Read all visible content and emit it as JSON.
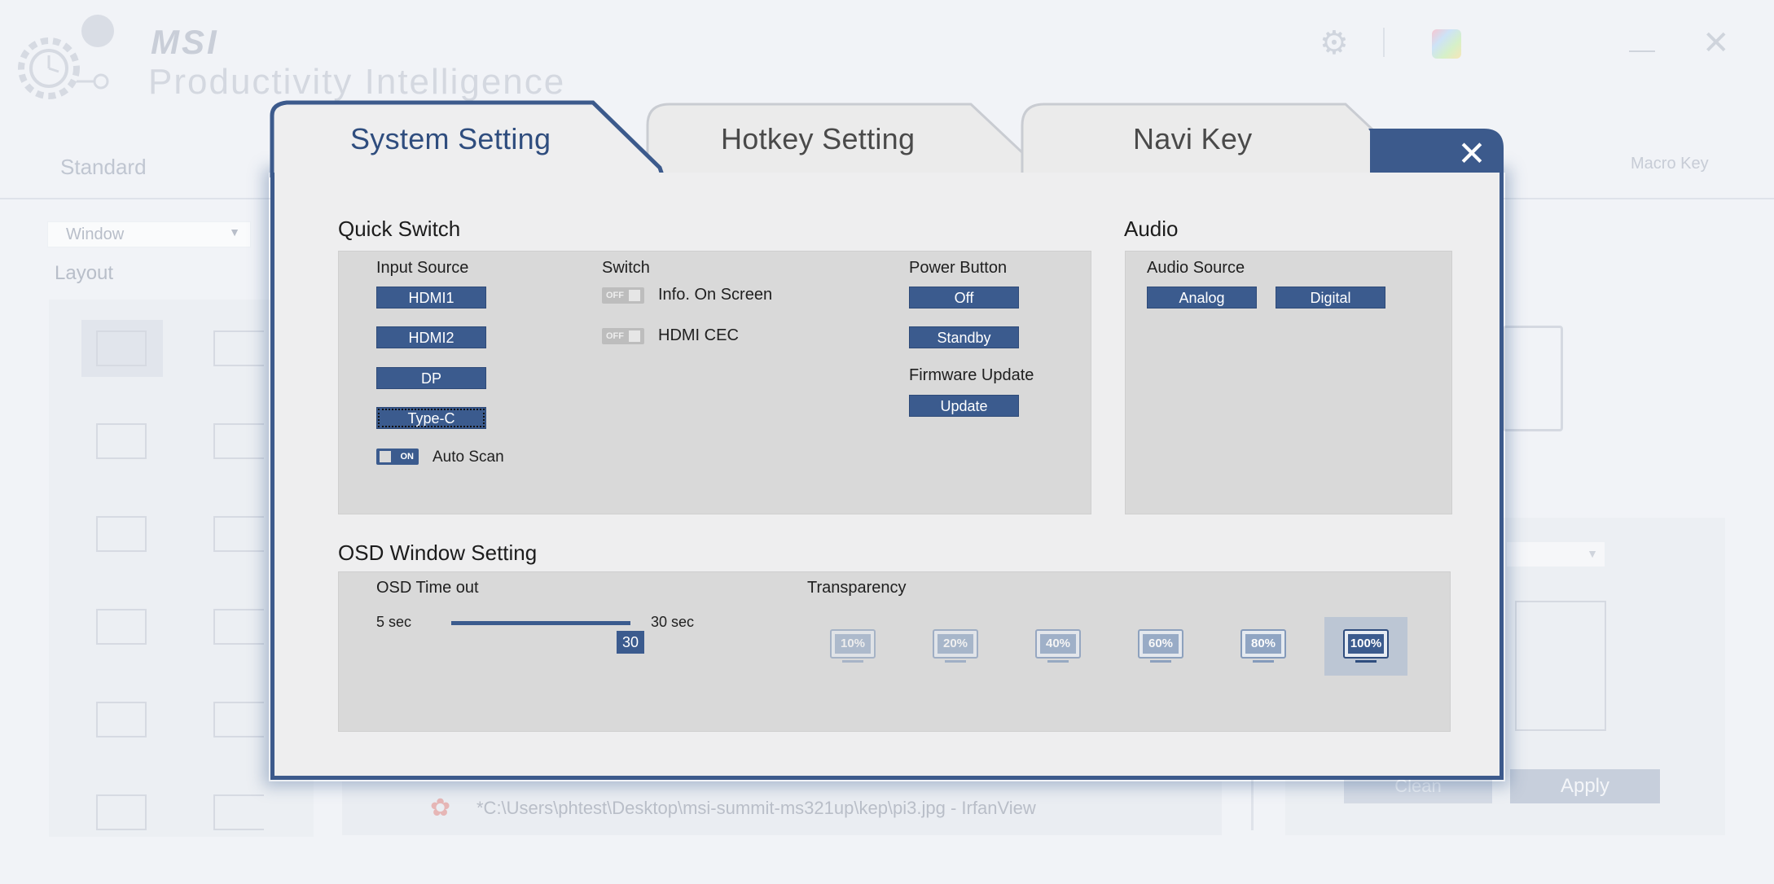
{
  "background": {
    "brand": "MSI",
    "app_title": "Productivity Intelligence",
    "tab_standard": "Standard",
    "tab_macro": "Macro Key",
    "window_select": "Window",
    "layout_label": "Layout",
    "recent_path": "*C:\\Users\\phtest\\Desktop\\msi-summit-ms321up\\kep\\pi3.jpg - IrfanView",
    "clean_label": "Clean",
    "apply_label": "Apply"
  },
  "dialog": {
    "tabs": [
      "System Setting",
      "Hotkey Setting",
      "Navi Key"
    ],
    "active_tab": "System Setting",
    "close_icon": "close-icon",
    "accent_color": "#3b5b8e"
  },
  "quick_switch": {
    "title": "Quick Switch",
    "input_source": {
      "label": "Input Source",
      "buttons": [
        "HDMI1",
        "HDMI2",
        "DP",
        "Type-C"
      ],
      "auto_scan": {
        "label": "Auto Scan",
        "state": "ON"
      }
    },
    "switch": {
      "label": "Switch",
      "items": [
        {
          "label": "Info. On Screen",
          "state": "OFF"
        },
        {
          "label": "HDMI CEC",
          "state": "OFF"
        }
      ]
    },
    "power_button": {
      "label": "Power Button",
      "buttons": [
        "Off",
        "Standby"
      ]
    },
    "firmware_update": {
      "label": "Firmware Update",
      "button": "Update"
    }
  },
  "audio": {
    "title": "Audio",
    "source_label": "Audio Source",
    "buttons": [
      "Analog",
      "Digital"
    ]
  },
  "osd": {
    "title": "OSD Window Setting",
    "timeout": {
      "label": "OSD Time out",
      "min_label": "5 sec",
      "max_label": "30 sec",
      "value": "30"
    },
    "transparency": {
      "label": "Transparency",
      "options": [
        "10%",
        "20%",
        "40%",
        "60%",
        "80%",
        "100%"
      ],
      "selected": "100%"
    }
  }
}
